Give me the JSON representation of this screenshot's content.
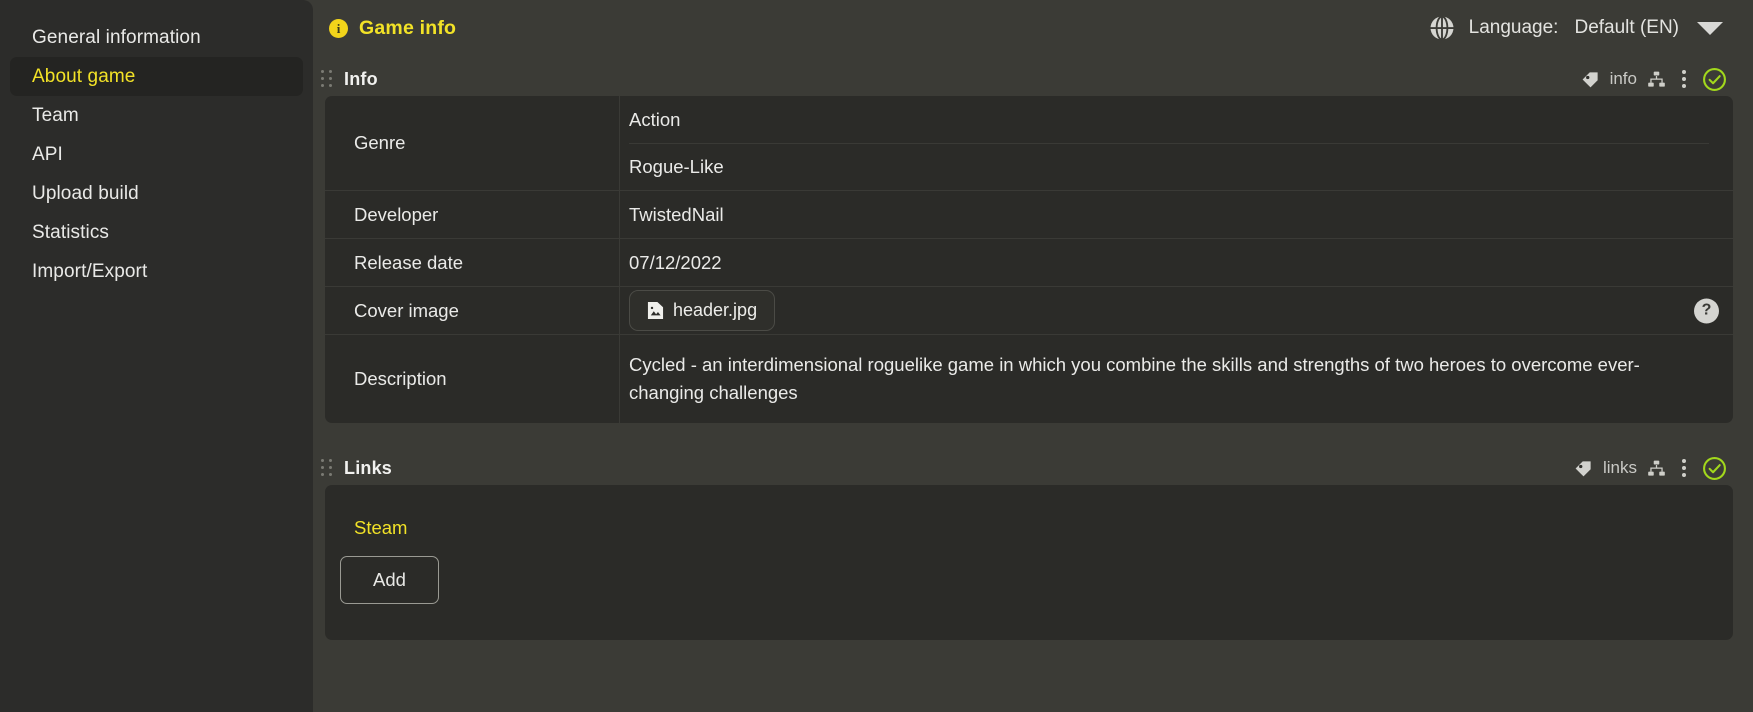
{
  "sidebar": {
    "items": [
      {
        "label": "General information",
        "active": false
      },
      {
        "label": "About game",
        "active": true
      },
      {
        "label": "Team",
        "active": false
      },
      {
        "label": "API",
        "active": false
      },
      {
        "label": "Upload build",
        "active": false
      },
      {
        "label": "Statistics",
        "active": false
      },
      {
        "label": "Import/Export",
        "active": false
      }
    ]
  },
  "header": {
    "icon": "info-circle-icon",
    "title": "Game info",
    "language_label": "Language:",
    "language_value": "Default (EN)",
    "globe_icon": "globe-icon",
    "caret_icon": "chevron-down-icon"
  },
  "info_section": {
    "drag_handle_icon": "drag-handle-icon",
    "title": "Info",
    "tag_icon": "tag-icon",
    "tag_text": "info",
    "tree_icon": "sitemap-icon",
    "kebab_icon": "more-vertical-icon",
    "status_icon": "check-circle-icon",
    "rows": [
      {
        "label": "Genre",
        "values": [
          "Action",
          "Rogue-Like"
        ]
      },
      {
        "label": "Developer",
        "values": [
          "TwistedNail"
        ]
      },
      {
        "label": "Release date",
        "values": [
          "07/12/2022"
        ]
      },
      {
        "label": "Cover image",
        "file": "header.jpg",
        "file_icon": "image-file-icon",
        "help": "?"
      },
      {
        "label": "Description",
        "values": [
          "Cycled - an interdimensional roguelike game in which you combine the skills and strengths of two heroes to overcome ever-changing challenges"
        ]
      }
    ]
  },
  "links_section": {
    "drag_handle_icon": "drag-handle-icon",
    "title": "Links",
    "tag_icon": "tag-icon",
    "tag_text": "links",
    "tree_icon": "sitemap-icon",
    "kebab_icon": "more-vertical-icon",
    "status_icon": "check-circle-icon",
    "groups": [
      {
        "name": "Steam",
        "add_label": "Add"
      }
    ]
  },
  "colors": {
    "accent_yellow": "#f2e227",
    "status_green": "#9fd51f",
    "sidebar_bg": "#2c2c2a",
    "content_bg": "#3b3b36",
    "panel_bg": "#2b2b28"
  }
}
